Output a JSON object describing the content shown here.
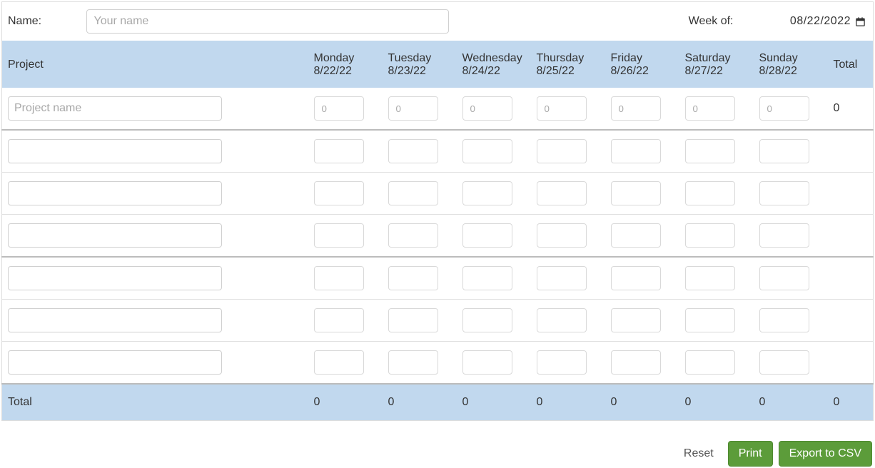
{
  "top": {
    "name_label": "Name:",
    "name_placeholder": "Your name",
    "week_label": "Week of:",
    "week_value": "08/22/2022"
  },
  "headers": {
    "project": "Project",
    "total": "Total",
    "days": [
      {
        "name": "Monday",
        "date": "8/22/22"
      },
      {
        "name": "Tuesday",
        "date": "8/23/22"
      },
      {
        "name": "Wednesday",
        "date": "8/24/22"
      },
      {
        "name": "Thursday",
        "date": "8/25/22"
      },
      {
        "name": "Friday",
        "date": "8/26/22"
      },
      {
        "name": "Saturday",
        "date": "8/27/22"
      },
      {
        "name": "Sunday",
        "date": "8/28/22"
      }
    ]
  },
  "rows": [
    {
      "project_placeholder": "Project name",
      "hour_placeholder": "0",
      "row_total": "0"
    },
    {
      "project_placeholder": "",
      "hour_placeholder": "",
      "row_total": ""
    },
    {
      "project_placeholder": "",
      "hour_placeholder": "",
      "row_total": ""
    },
    {
      "project_placeholder": "",
      "hour_placeholder": "",
      "row_total": ""
    },
    {
      "project_placeholder": "",
      "hour_placeholder": "",
      "row_total": ""
    },
    {
      "project_placeholder": "",
      "hour_placeholder": "",
      "row_total": ""
    },
    {
      "project_placeholder": "",
      "hour_placeholder": "",
      "row_total": ""
    }
  ],
  "footer": {
    "label": "Total",
    "day_totals": [
      "0",
      "0",
      "0",
      "0",
      "0",
      "0",
      "0"
    ],
    "grand_total": "0"
  },
  "actions": {
    "reset": "Reset",
    "print": "Print",
    "export": "Export to CSV"
  }
}
